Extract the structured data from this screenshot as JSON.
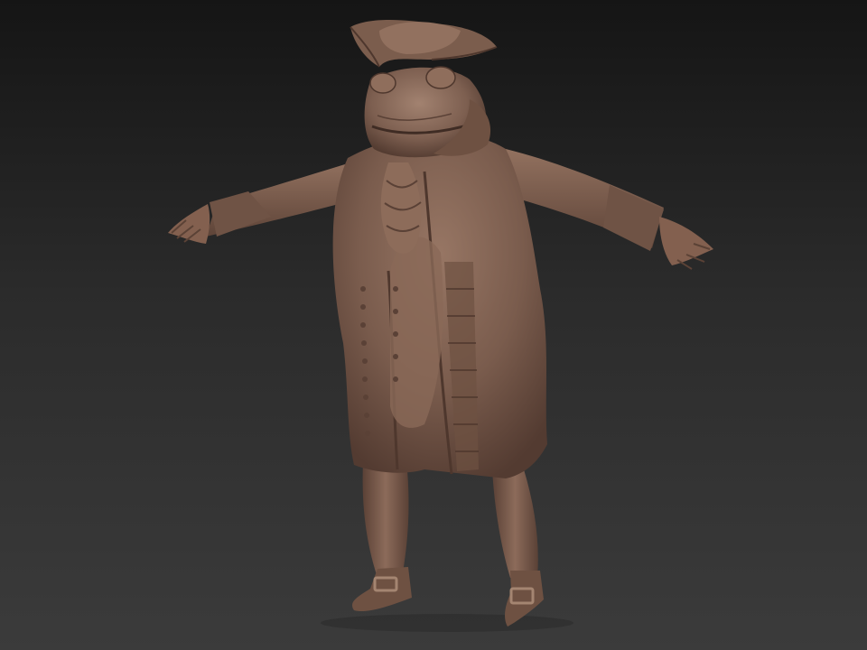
{
  "scene": {
    "subject": "sculpted-toad-figure",
    "background_top": "#151515",
    "background_bottom": "#3b3b3b",
    "material_base": "#7a5c4d",
    "material_light": "#9b7b69",
    "material_shadow": "#4a352b"
  }
}
